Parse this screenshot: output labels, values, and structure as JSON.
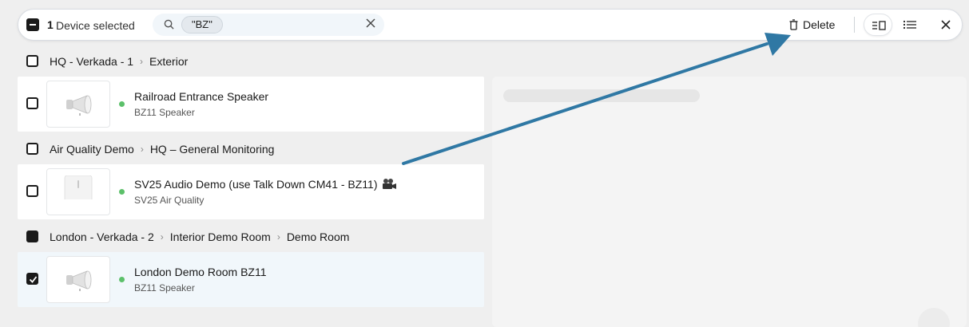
{
  "toolbar": {
    "selected_count": "1",
    "selected_label": "Device selected",
    "search_chip": "\"BZ\"",
    "delete_label": "Delete"
  },
  "groups": [
    {
      "path": [
        "HQ - Verkada - 1",
        "Exterior"
      ],
      "devices": [
        {
          "name": "Railroad Entrance Speaker",
          "model": "BZ11 Speaker",
          "status": "online",
          "checked": false,
          "icon": "speaker-horn-icon"
        }
      ]
    },
    {
      "path": [
        "Air Quality Demo",
        "HQ – General Monitoring"
      ],
      "devices": [
        {
          "name": "SV25 Audio Demo (use Talk Down CM41 - BZ11)",
          "model": "SV25 Air Quality",
          "status": "online",
          "checked": false,
          "icon": "air-sensor-icon"
        }
      ]
    },
    {
      "path": [
        "London - Verkada - 2",
        "Interior Demo Room",
        "Demo Room"
      ],
      "devices": [
        {
          "name": "London Demo Room BZ11",
          "model": "BZ11 Speaker",
          "status": "online",
          "checked": true,
          "icon": "speaker-horn-icon"
        }
      ]
    }
  ],
  "colors": {
    "status_online": "#5cc06a",
    "arrow": "#2f78a4",
    "selected_row": "#f1f7fb"
  }
}
